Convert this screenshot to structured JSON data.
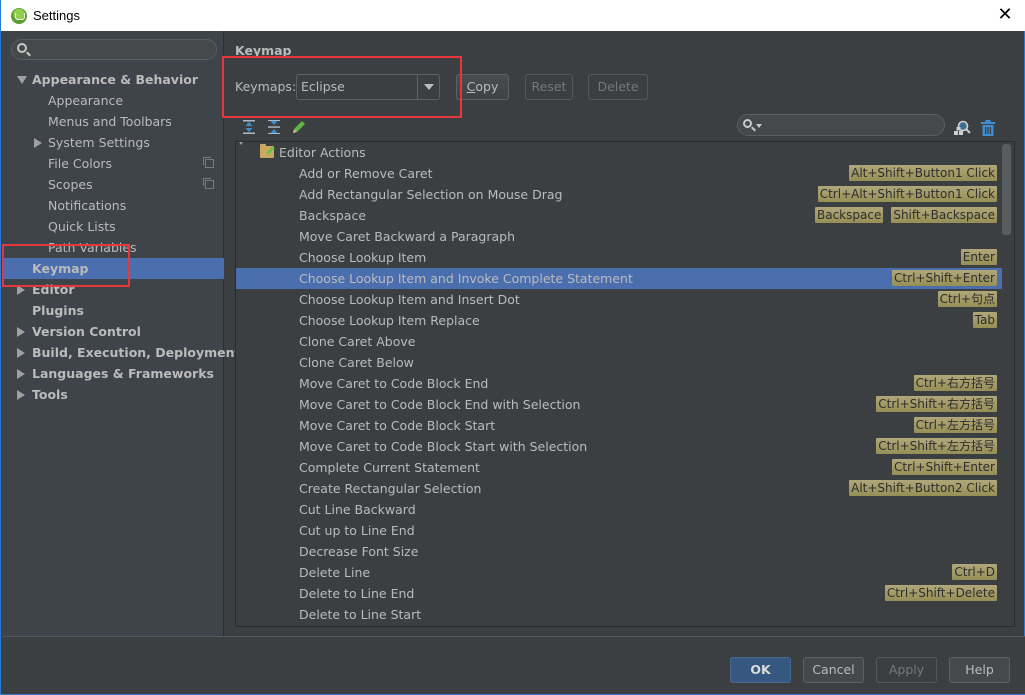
{
  "window": {
    "title": "Settings",
    "close_glyph": "✕"
  },
  "sidebar": {
    "search_placeholder": "",
    "items": [
      {
        "label": "Appearance & Behavior",
        "level": 0,
        "bold": true,
        "expander": "down"
      },
      {
        "label": "Appearance",
        "level": 1
      },
      {
        "label": "Menus and Toolbars",
        "level": 1
      },
      {
        "label": "System Settings",
        "level": 1,
        "expander": "right"
      },
      {
        "label": "File Colors",
        "level": 1,
        "project_icon": true
      },
      {
        "label": "Scopes",
        "level": 1,
        "project_icon": true
      },
      {
        "label": "Notifications",
        "level": 1
      },
      {
        "label": "Quick Lists",
        "level": 1
      },
      {
        "label": "Path Variables",
        "level": 1
      },
      {
        "label": "Keymap",
        "level": 0,
        "bold": true,
        "selected": true
      },
      {
        "label": "Editor",
        "level": 0,
        "bold": true,
        "expander": "right"
      },
      {
        "label": "Plugins",
        "level": 0,
        "bold": true
      },
      {
        "label": "Version Control",
        "level": 0,
        "bold": true,
        "expander": "right"
      },
      {
        "label": "Build, Execution, Deployment",
        "level": 0,
        "bold": true,
        "expander": "right"
      },
      {
        "label": "Languages & Frameworks",
        "level": 0,
        "bold": true,
        "expander": "right"
      },
      {
        "label": "Tools",
        "level": 0,
        "bold": true,
        "expander": "right"
      }
    ]
  },
  "main": {
    "section_title": "Keymap",
    "keymaps_label": "Keymaps:",
    "keymap_selected": "Eclipse",
    "buttons": {
      "copy_mnemonic": "C",
      "copy_rest": "opy",
      "reset": "Reset",
      "delete": "Delete"
    },
    "filter_placeholder": "",
    "tree": {
      "group": "Editor Actions",
      "actions": [
        {
          "name": "Add or Remove Caret",
          "shortcuts": [
            "Alt+Shift+Button1 Click"
          ]
        },
        {
          "name": "Add Rectangular Selection on Mouse Drag",
          "shortcuts": [
            "Ctrl+Alt+Shift+Button1 Click"
          ]
        },
        {
          "name": "Backspace",
          "shortcuts": [
            "Backspace",
            "Shift+Backspace"
          ]
        },
        {
          "name": "Move Caret Backward a Paragraph",
          "shortcuts": []
        },
        {
          "name": "Choose Lookup Item",
          "shortcuts": [
            "Enter"
          ]
        },
        {
          "name": "Choose Lookup Item and Invoke Complete Statement",
          "shortcuts": [
            "Ctrl+Shift+Enter"
          ],
          "selected": true
        },
        {
          "name": "Choose Lookup Item and Insert Dot",
          "shortcuts": [
            "Ctrl+句点"
          ]
        },
        {
          "name": "Choose Lookup Item Replace",
          "shortcuts": [
            "Tab"
          ]
        },
        {
          "name": "Clone Caret Above",
          "shortcuts": []
        },
        {
          "name": "Clone Caret Below",
          "shortcuts": []
        },
        {
          "name": "Move Caret to Code Block End",
          "shortcuts": [
            "Ctrl+右方括号"
          ]
        },
        {
          "name": "Move Caret to Code Block End with Selection",
          "shortcuts": [
            "Ctrl+Shift+右方括号"
          ]
        },
        {
          "name": "Move Caret to Code Block Start",
          "shortcuts": [
            "Ctrl+左方括号"
          ]
        },
        {
          "name": "Move Caret to Code Block Start with Selection",
          "shortcuts": [
            "Ctrl+Shift+左方括号"
          ]
        },
        {
          "name": "Complete Current Statement",
          "shortcuts": [
            "Ctrl+Shift+Enter"
          ]
        },
        {
          "name": "Create Rectangular Selection",
          "shortcuts": [
            "Alt+Shift+Button2 Click"
          ]
        },
        {
          "name": "Cut Line Backward",
          "shortcuts": []
        },
        {
          "name": "Cut up to Line End",
          "shortcuts": []
        },
        {
          "name": "Decrease Font Size",
          "shortcuts": []
        },
        {
          "name": "Delete Line",
          "shortcuts": [
            "Ctrl+D"
          ]
        },
        {
          "name": "Delete to Line End",
          "shortcuts": [
            "Ctrl+Shift+Delete"
          ]
        },
        {
          "name": "Delete to Line Start",
          "shortcuts": []
        }
      ]
    }
  },
  "footer": {
    "ok": "OK",
    "cancel": "Cancel",
    "apply": "Apply",
    "help": "Help"
  },
  "colors": {
    "selection": "#4b6eaf",
    "shortcut_badge": "#a39d66",
    "highlight_box": "#e8373a",
    "ok_button": "#365880"
  }
}
